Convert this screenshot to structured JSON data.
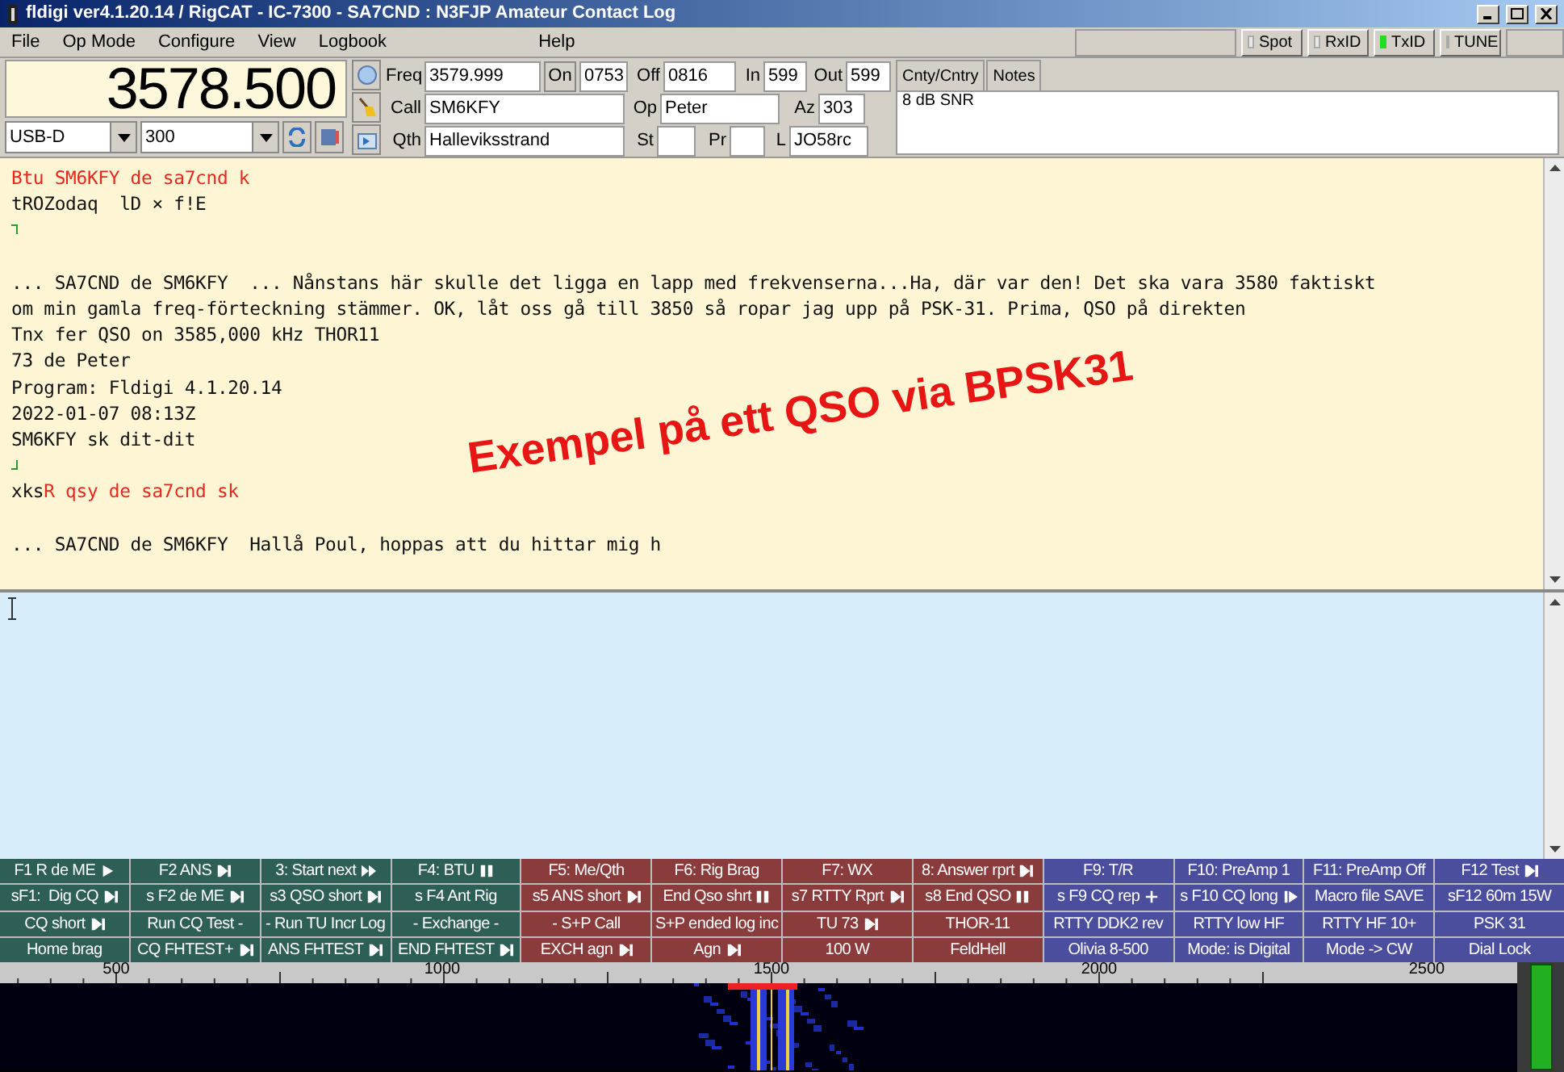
{
  "window": {
    "title": "fldigi ver4.1.20.14 / RigCAT - IC-7300 - SA7CND : N3FJP Amateur Contact Log"
  },
  "menu": [
    "File",
    "Op Mode",
    "Configure",
    "View",
    "Logbook",
    "Help"
  ],
  "indicators": [
    {
      "label": "Spot",
      "on": false
    },
    {
      "label": "RxID",
      "on": false
    },
    {
      "label": "TxID",
      "on": true
    },
    {
      "label": "TUNE",
      "on": false
    }
  ],
  "frequency_display": "3578.500",
  "mode": "USB-D",
  "bandwidth": "300",
  "log_rows": [
    [
      {
        "kind": "label",
        "text": "Freq"
      },
      {
        "kind": "field",
        "text": "3579.999"
      },
      {
        "kind": "button",
        "text": "On"
      },
      {
        "kind": "field",
        "text": "0753"
      },
      {
        "kind": "label",
        "text": "Off"
      },
      {
        "kind": "field",
        "text": "0816"
      },
      {
        "kind": "label",
        "text": "In"
      },
      {
        "kind": "field",
        "text": "599"
      },
      {
        "kind": "label",
        "text": "Out"
      },
      {
        "kind": "field",
        "text": "599"
      }
    ],
    [
      {
        "kind": "label",
        "text": "Call"
      },
      {
        "kind": "field",
        "text": "SM6KFY"
      },
      {
        "kind": "label",
        "text": "Op"
      },
      {
        "kind": "field",
        "text": "Peter"
      },
      {
        "kind": "label",
        "text": "Az"
      },
      {
        "kind": "field",
        "text": "303"
      }
    ],
    [
      {
        "kind": "label",
        "text": "Qth"
      },
      {
        "kind": "field",
        "text": "Halleviksstrand"
      },
      {
        "kind": "label",
        "text": "St"
      },
      {
        "kind": "field"
      },
      {
        "kind": "label",
        "text": "Pr"
      },
      {
        "kind": "field"
      },
      {
        "kind": "label",
        "text": "L"
      },
      {
        "kind": "field",
        "text": "JO58rc"
      }
    ]
  ],
  "info_tabs": [
    "Cnty/Cntry",
    "Notes"
  ],
  "info_text": "8 dB SNR",
  "rx_lines": [
    {
      "kind": "text",
      "segments": [
        {
          "text": "Btu SM6KFY de sa7cnd k",
          "tx": true
        }
      ]
    },
    {
      "kind": "text",
      "segments": [
        {
          "text": "tROZodaq  lD × f!E",
          "tx": false
        }
      ]
    },
    {
      "kind": "opener"
    },
    {
      "kind": "blank"
    },
    {
      "kind": "text",
      "segments": [
        {
          "text": "... SA7CND de SM6KFY  ... Nånstans här skulle det ligga en lapp med frekvenserna...Ha, där var den! Det ska vara 3580 faktiskt",
          "tx": false
        }
      ]
    },
    {
      "kind": "text",
      "segments": [
        {
          "text": "om min gamla freq-förteckning stämmer. OK, låt oss gå till 3850 så ropar jag upp på PSK-31. Prima, QSO på direkten",
          "tx": false
        }
      ]
    },
    {
      "kind": "text",
      "segments": [
        {
          "text": "Tnx fer QSO on 3585,000 kHz THOR11",
          "tx": false
        }
      ]
    },
    {
      "kind": "text",
      "segments": [
        {
          "text": "73 de Peter",
          "tx": false
        }
      ]
    },
    {
      "kind": "text",
      "segments": [
        {
          "text": "Program: Fldigi 4.1.20.14",
          "tx": false
        }
      ]
    },
    {
      "kind": "text",
      "segments": [
        {
          "text": "2022-01-07 08:13Z",
          "tx": false
        }
      ]
    },
    {
      "kind": "text",
      "segments": [
        {
          "text": "SM6KFY sk dit-dit",
          "tx": false
        }
      ]
    },
    {
      "kind": "closer"
    },
    {
      "kind": "text",
      "segments": [
        {
          "text": "xks",
          "tx": false
        },
        {
          "text": "R qsy de sa7cnd sk",
          "tx": true
        }
      ]
    },
    {
      "kind": "blank"
    },
    {
      "kind": "text",
      "segments": [
        {
          "text": "... SA7CND de SM6KFY  Hallå Poul, hoppas att du hittar mig h",
          "tx": false
        }
      ]
    }
  ],
  "annotation": "Exempel på ett QSO via BPSK31",
  "macros": [
    [
      {
        "label": "F1 R de ME",
        "color": "#2e5f57",
        "kind": "play"
      },
      {
        "label": "F2 ANS",
        "color": "#2e5f57",
        "kind": "skip"
      },
      {
        "label": "3: Start next",
        "color": "#2e5f57",
        "kind": "fast"
      },
      {
        "label": "F4: BTU",
        "color": "#2e5f57",
        "kind": "pause"
      },
      {
        "label": "F5: Me/Qth",
        "color": "#8a3b3b",
        "kind": "plain"
      },
      {
        "label": "F6: Rig Brag",
        "color": "#8a3b3b",
        "kind": "plain"
      },
      {
        "label": "F7: WX",
        "color": "#8a3b3b",
        "kind": "plain"
      },
      {
        "label": "8: Answer rprt",
        "color": "#8a3b3b",
        "kind": "skip"
      },
      {
        "label": "F9: T/R",
        "color": "#4b4e9c",
        "kind": "plain"
      },
      {
        "label": "F10: PreAmp 1",
        "color": "#4b4e9c",
        "kind": "plain"
      },
      {
        "label": "F11: PreAmp Off",
        "color": "#4b4e9c",
        "kind": "plain"
      },
      {
        "label": "F12 Test",
        "color": "#4b4e9c",
        "kind": "skip"
      }
    ],
    [
      {
        "label": "sF1:  Dig CQ",
        "color": "#2e5f57",
        "kind": "skip"
      },
      {
        "label": "s F2 de ME",
        "color": "#2e5f57",
        "kind": "skip"
      },
      {
        "label": "s3 QSO short",
        "color": "#2e5f57",
        "kind": "skip"
      },
      {
        "label": "s F4 Ant Rig",
        "color": "#2e5f57",
        "kind": "plain"
      },
      {
        "label": "s5 ANS short",
        "color": "#8a3b3b",
        "kind": "skip"
      },
      {
        "label": "End Qso shrt",
        "color": "#8a3b3b",
        "kind": "pause"
      },
      {
        "label": "s7 RTTY Rprt",
        "color": "#8a3b3b",
        "kind": "skip"
      },
      {
        "label": "s8 End QSO",
        "color": "#8a3b3b",
        "kind": "pause"
      },
      {
        "label": "s F9 CQ rep",
        "color": "#4b4e9c",
        "kind": "plus"
      },
      {
        "label": "s F10 CQ long",
        "color": "#4b4e9c",
        "kind": "step"
      },
      {
        "label": "Macro file SAVE",
        "color": "#4b4e9c",
        "kind": "plain"
      },
      {
        "label": "sF12 60m 15W",
        "color": "#4b4e9c",
        "kind": "plain"
      }
    ],
    [
      {
        "label": "CQ short",
        "color": "#2e5f57",
        "kind": "skip"
      },
      {
        "label": "Run CQ Test -",
        "color": "#2e5f57",
        "kind": "plain"
      },
      {
        "label": "- Run TU Incr Log",
        "color": "#2e5f57",
        "kind": "plain"
      },
      {
        "label": "- Exchange -",
        "color": "#2e5f57",
        "kind": "plain"
      },
      {
        "label": "- S+P Call",
        "color": "#8a3b3b",
        "kind": "plain"
      },
      {
        "label": "S+P ended log inc",
        "color": "#8a3b3b",
        "kind": "plain"
      },
      {
        "label": "TU 73",
        "color": "#8a3b3b",
        "kind": "skip"
      },
      {
        "label": "THOR-11",
        "color": "#8a3b3b",
        "kind": "plain"
      },
      {
        "label": "RTTY DDK2 rev",
        "color": "#4b4e9c",
        "kind": "plain"
      },
      {
        "label": "RTTY low HF",
        "color": "#4b4e9c",
        "kind": "plain"
      },
      {
        "label": "RTTY HF 10+",
        "color": "#4b4e9c",
        "kind": "plain"
      },
      {
        "label": "PSK 31",
        "color": "#4b4e9c",
        "kind": "plain"
      }
    ],
    [
      {
        "label": "Home brag",
        "color": "#2e5f57",
        "kind": "plain"
      },
      {
        "label": "CQ FHTEST+",
        "color": "#2e5f57",
        "kind": "skip"
      },
      {
        "label": "ANS FHTEST",
        "color": "#2e5f57",
        "kind": "skip"
      },
      {
        "label": "END FHTEST",
        "color": "#2e5f57",
        "kind": "skip"
      },
      {
        "label": "EXCH agn",
        "color": "#8a3b3b",
        "kind": "skip"
      },
      {
        "label": "Agn",
        "color": "#8a3b3b",
        "kind": "skip"
      },
      {
        "label": "100 W",
        "color": "#8a3b3b",
        "kind": "plain"
      },
      {
        "label": "FeldHell",
        "color": "#8a3b3b",
        "kind": "plain"
      },
      {
        "label": "Olivia 8-500",
        "color": "#4b4e9c",
        "kind": "plain"
      },
      {
        "label": "Mode: is Digital",
        "color": "#4b4e9c",
        "kind": "plain"
      },
      {
        "label": "Mode -> CW",
        "color": "#4b4e9c",
        "kind": "plain"
      },
      {
        "label": "Dial Lock",
        "color": "#4b4e9c",
        "kind": "plain"
      }
    ]
  ],
  "waterfall_scale": [
    "500",
    "1000",
    "1500",
    "2000",
    "2500"
  ]
}
